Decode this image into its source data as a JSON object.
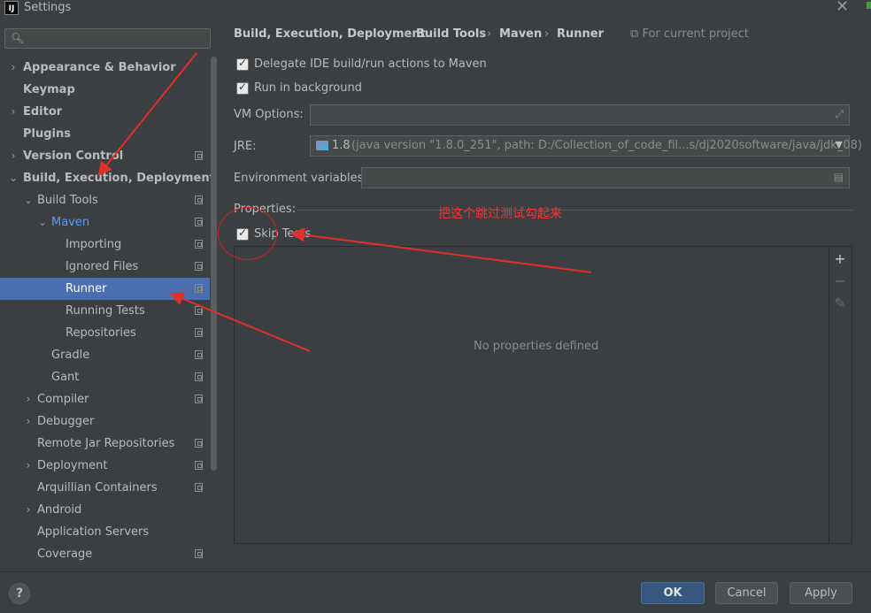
{
  "window": {
    "title": "Settings",
    "app_icon": "IJ"
  },
  "search": {
    "placeholder": "",
    "icon": "search-icon"
  },
  "sidebar": {
    "items": [
      {
        "label": "Appearance & Behavior",
        "arrow": "›"
      },
      {
        "label": "Keymap"
      },
      {
        "label": "Editor",
        "arrow": "›"
      },
      {
        "label": "Plugins"
      },
      {
        "label": "Version Control",
        "arrow": "›"
      },
      {
        "label": "Build, Execution, Deployment",
        "arrow": "⌄"
      },
      {
        "label": "Build Tools",
        "arrow": "⌄"
      },
      {
        "label": "Maven",
        "arrow": "⌄"
      },
      {
        "label": "Importing"
      },
      {
        "label": "Ignored Files"
      },
      {
        "label": "Runner"
      },
      {
        "label": "Running Tests"
      },
      {
        "label": "Repositories"
      },
      {
        "label": "Gradle"
      },
      {
        "label": "Gant"
      },
      {
        "label": "Compiler",
        "arrow": "›"
      },
      {
        "label": "Debugger",
        "arrow": "›"
      },
      {
        "label": "Remote Jar Repositories"
      },
      {
        "label": "Deployment",
        "arrow": "›"
      },
      {
        "label": "Arquillian Containers"
      },
      {
        "label": "Android",
        "arrow": "›"
      },
      {
        "label": "Application Servers"
      },
      {
        "label": "Coverage"
      }
    ]
  },
  "breadcrumb": {
    "items": [
      "Build, Execution, Deployment",
      "Build Tools",
      "Maven",
      "Runner"
    ],
    "separator": "›",
    "scope": "For current project"
  },
  "runner": {
    "delegate_label": "Delegate IDE build/run actions to Maven",
    "background_label": "Run in background",
    "vm_options_label": "VM Options:",
    "vm_options_value": "",
    "jre_label": "JRE:",
    "jre_version": "1.8",
    "jre_path": "(java version \"1.8.0_251\", path: D:/Collection_of_code_fil...s/dj2020software/java/jdk_08)",
    "env_label": "Environment variables:",
    "env_value": "",
    "properties_label": "Properties:",
    "skip_tests_label": "Skip Tests",
    "empty_properties": "No properties defined"
  },
  "annotation": {
    "text": "把这个跳过测试勾起来",
    "color": "#ff2f2f"
  },
  "buttons": {
    "ok": "OK",
    "cancel": "Cancel",
    "apply": "Apply",
    "help": "?"
  },
  "colors": {
    "accent": "#4b6eaf",
    "primary_button": "#365880",
    "link_blue": "#589df6"
  }
}
